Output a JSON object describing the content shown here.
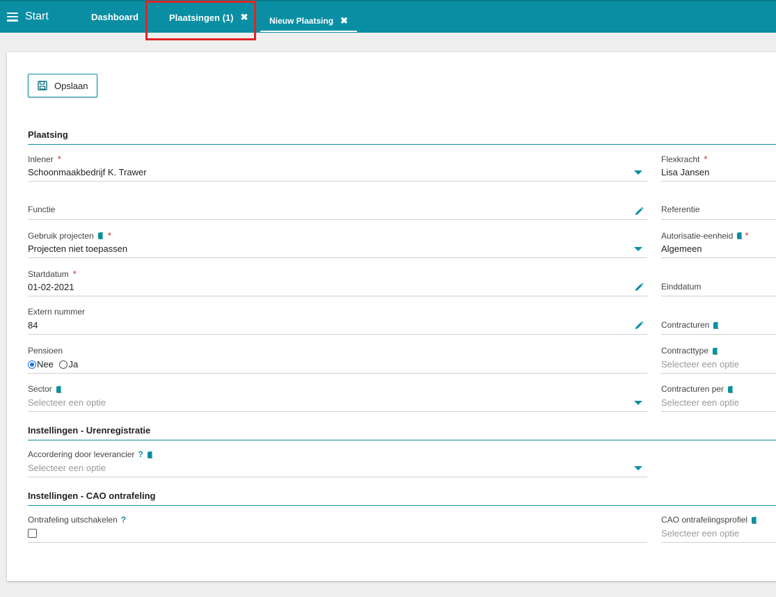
{
  "topbar": {
    "menu_label": "Start",
    "tabs": [
      {
        "label": "Dashboard"
      },
      {
        "label": "Plaatsingen (1)"
      },
      {
        "label": "Nieuw Plaatsing"
      }
    ],
    "close_glyph": "✖"
  },
  "toolbar": {
    "save_label": "Opslaan"
  },
  "sections": {
    "plaatsing": "Plaatsing",
    "urenregistratie": "Instellingen - Urenregistratie",
    "cao": "Instellingen - CAO ontrafeling"
  },
  "left": {
    "inlener": {
      "label": "Inlener",
      "value": "Schoonmaakbedrijf K. Trawer"
    },
    "functie": {
      "label": "Functie"
    },
    "gebruik_projecten": {
      "label": "Gebruik projecten",
      "value": "Projecten niet toepassen"
    },
    "startdatum": {
      "label": "Startdatum",
      "value": "01-02-2021"
    },
    "extern_nummer": {
      "label": "Extern nummer",
      "value": "84"
    },
    "pensioen": {
      "label": "Pensioen",
      "options": [
        "Nee",
        "Ja"
      ],
      "selected": "Nee"
    },
    "sector": {
      "label": "Sector",
      "placeholder": "Selecteer een optie"
    },
    "accordering": {
      "label": "Accordering door leverancier",
      "placeholder": "Selecteer een optie"
    },
    "ontrafeling": {
      "label": "Ontrafeling uitschakelen"
    }
  },
  "right": {
    "flexkracht": {
      "label": "Flexkracht",
      "value": "Lisa Jansen"
    },
    "referentie": {
      "label": "Referentie"
    },
    "autorisatie": {
      "label": "Autorisatie-eenheid",
      "value": "Algemeen"
    },
    "einddatum": {
      "label": "Einddatum"
    },
    "contracturen": {
      "label": "Contracturen"
    },
    "contracttype": {
      "label": "Contracttype",
      "placeholder": "Selecteer een optie"
    },
    "contracturen_per": {
      "label": "Contracturen per",
      "placeholder": "Selecteer een optie"
    },
    "cao_profiel": {
      "label": "CAO ontrafelingsprofiel",
      "placeholder": "Selecteer een optie"
    }
  },
  "required_mark": "*",
  "help_mark": "?",
  "colors": {
    "accent": "#0a8ea3",
    "required": "#e02424",
    "highlight": "#e02424"
  }
}
